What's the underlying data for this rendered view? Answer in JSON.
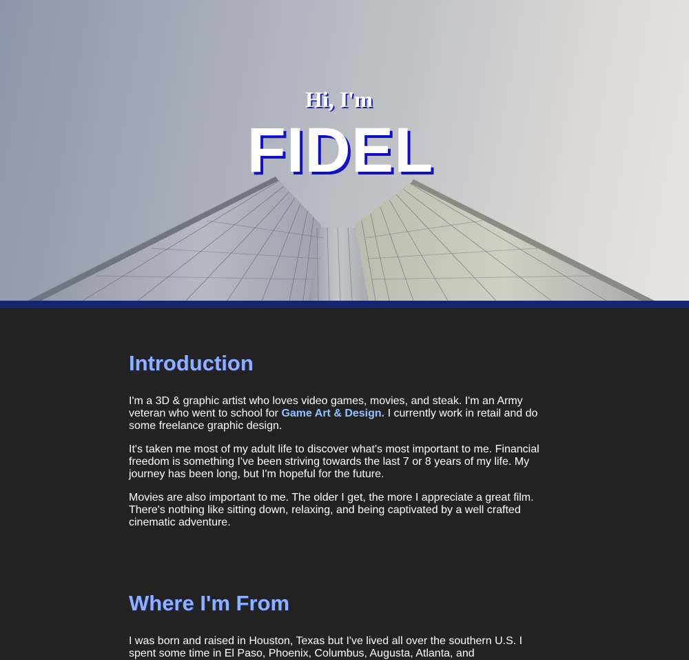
{
  "hero": {
    "greeting": "Hi, I'm",
    "name": "FIDEL"
  },
  "colors": {
    "accent": "#8fb0ff",
    "link": "#8ec2ff",
    "divider": "#15256e",
    "background": "#222222"
  },
  "intro": {
    "title": "Introduction",
    "p1_before": "I'm a 3D & graphic artist who loves video games, movies, and steak. I'm an Army veteran who went to school for ",
    "p1_link": "Game Art & Design.",
    "p1_after": " I currently work in retail and do some freelance graphic design.",
    "p2": "It's taken me most of my adult life to discover what's most important to me. Financial freedom is something I've been striving towards the last 7 or 8 years of my life. My journey has been long, but I'm hopeful for the future.",
    "p3": "Movies are also important to me. The older I get, the more I appreciate a great film. There's nothing like sitting down, relaxing, and being captivated by a well crafted cinematic adventure."
  },
  "where_from": {
    "title": "Where I'm From",
    "p1": "I was born and raised in Houston, Texas but I've lived all over the southern U.S. I spent some time in El Paso, Phoenix, Columbus, Augusta, Atlanta, and"
  }
}
